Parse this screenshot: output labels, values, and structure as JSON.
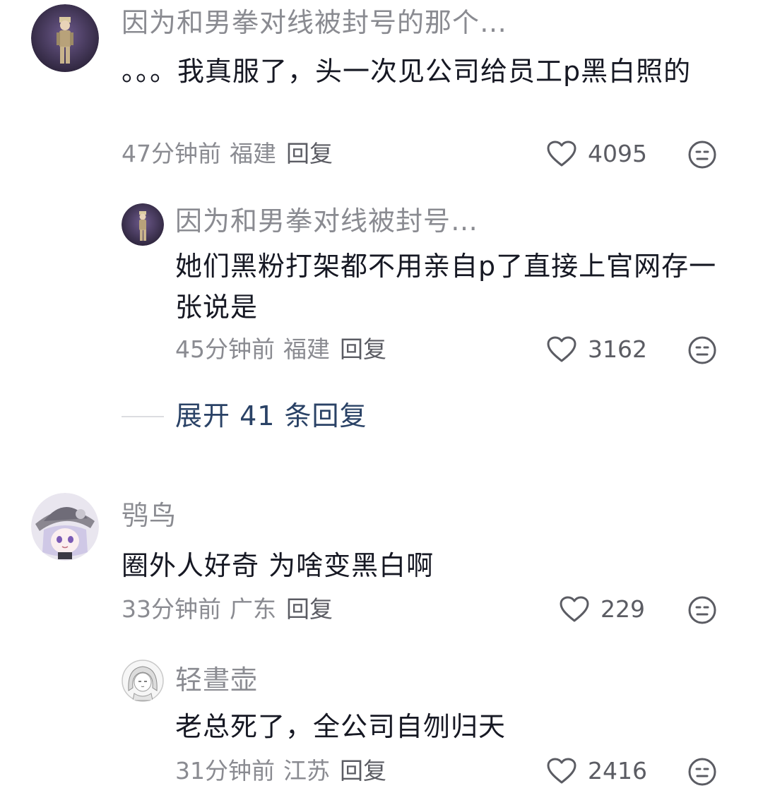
{
  "comments": [
    {
      "username": "因为和男拳对线被封号的那个…",
      "text": "。。。我真服了，头一次见公司给员工p黑白照的",
      "time": "47分钟前",
      "location": "福建",
      "reply_label": "回复",
      "likes": "4095",
      "avatar_icon": "anime-character-avatar",
      "replies": [
        {
          "username": "因为和男拳对线被封号…",
          "text": "她们黑粉打架都不用亲自p了直接上官网存一张说是",
          "time": "45分钟前",
          "location": "福建",
          "reply_label": "回复",
          "likes": "3162",
          "avatar_icon": "anime-character-avatar"
        }
      ],
      "expand_label": "展开 41 条回复"
    },
    {
      "username": "鸮鸟",
      "text": "圈外人好奇 为啥变黑白啊",
      "time": "33分钟前",
      "location": "广东",
      "reply_label": "回复",
      "likes": "229",
      "avatar_icon": "anime-girl-hat-avatar",
      "replies": [
        {
          "username": "轻晝壶",
          "text": "老总死了，全公司自刎归天",
          "time": "31分钟前",
          "location": "江苏",
          "reply_label": "回复",
          "likes": "2416",
          "avatar_icon": "sketch-girl-avatar"
        }
      ]
    }
  ],
  "colors": {
    "text_primary": "#161823",
    "text_secondary": "#8a8b91",
    "expand_link": "#2a4266"
  }
}
